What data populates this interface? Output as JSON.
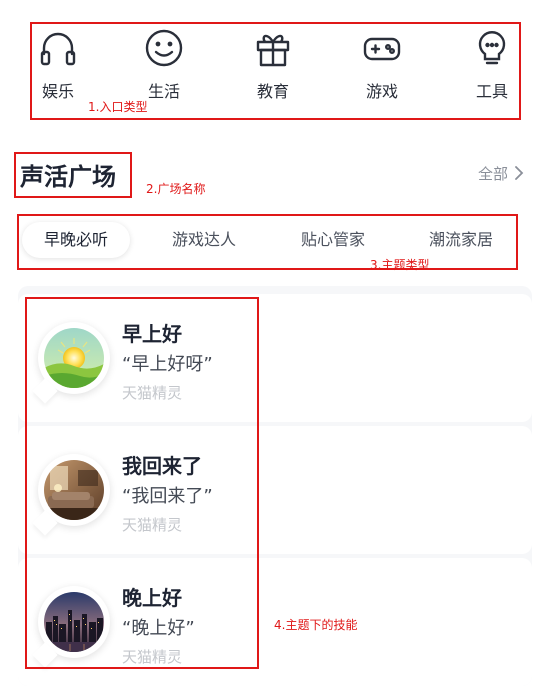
{
  "categories": [
    {
      "label": "娱乐",
      "icon": "headphones-icon"
    },
    {
      "label": "生活",
      "icon": "smile-icon"
    },
    {
      "label": "教育",
      "icon": "gift-icon"
    },
    {
      "label": "游戏",
      "icon": "gamepad-icon"
    },
    {
      "label": "工具",
      "icon": "lightbulb-icon"
    }
  ],
  "section": {
    "title": "声活广场",
    "all_label": "全部"
  },
  "tabs": [
    {
      "label": "早晚必听",
      "active": true
    },
    {
      "label": "游戏达人",
      "active": false
    },
    {
      "label": "贴心管家",
      "active": false
    },
    {
      "label": "潮流家居",
      "active": false
    }
  ],
  "cards": [
    {
      "title": "早上好",
      "phrase": "“早上好呀”",
      "source": "天猫精灵",
      "image": "sunrise-image"
    },
    {
      "title": "我回来了",
      "phrase": "“我回来了”",
      "source": "天猫精灵",
      "image": "living-room-image"
    },
    {
      "title": "晚上好",
      "phrase": "“晚上好”",
      "source": "天猫精灵",
      "image": "night-city-image"
    }
  ],
  "annotations": {
    "entry_type": "1.入口类型",
    "plaza_name": "2.广场名称",
    "theme_type": "3.主题类型",
    "theme_skills": "4.主题下的技能"
  },
  "colors": {
    "annotation": "#e01818",
    "title": "#1e2433",
    "muted": "#8a8f99",
    "source": "#c4c7cc"
  }
}
